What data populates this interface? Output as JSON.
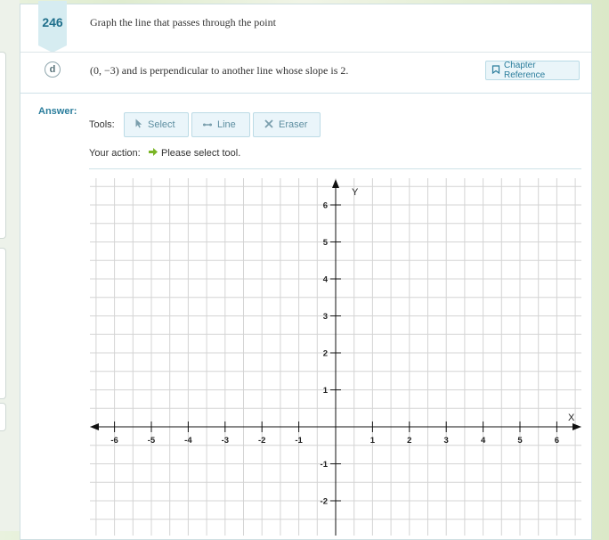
{
  "problem": {
    "number": "246",
    "question_line1": "Graph the line that passes through the point",
    "part_label": "d",
    "question_line2": "(0, −3) and is perpendicular to another line whose slope is 2.",
    "chapter_reference": "Chapter Reference"
  },
  "answer": {
    "label": "Answer:",
    "tools_label": "Tools:",
    "tools": [
      {
        "label": "Select",
        "icon": "cursor-icon"
      },
      {
        "label": "Line",
        "icon": "line-icon"
      },
      {
        "label": "Eraser",
        "icon": "eraser-icon"
      }
    ],
    "your_action_label": "Your action:",
    "action_text": "Please select tool.",
    "colors": {
      "accent": "#2a7d9c",
      "arrow": "#7ab526"
    }
  },
  "chart_data": {
    "type": "scatter",
    "xlabel": "X",
    "ylabel": "Y",
    "xlim": [
      -6,
      6
    ],
    "ylim": [
      -2,
      6
    ],
    "x_ticks": [
      -6,
      -5,
      -4,
      -3,
      -2,
      -1,
      1,
      2,
      3,
      4,
      5,
      6
    ],
    "y_ticks": [
      6,
      5,
      4,
      3,
      2,
      1,
      -1,
      -2
    ],
    "grid": true,
    "series": []
  }
}
